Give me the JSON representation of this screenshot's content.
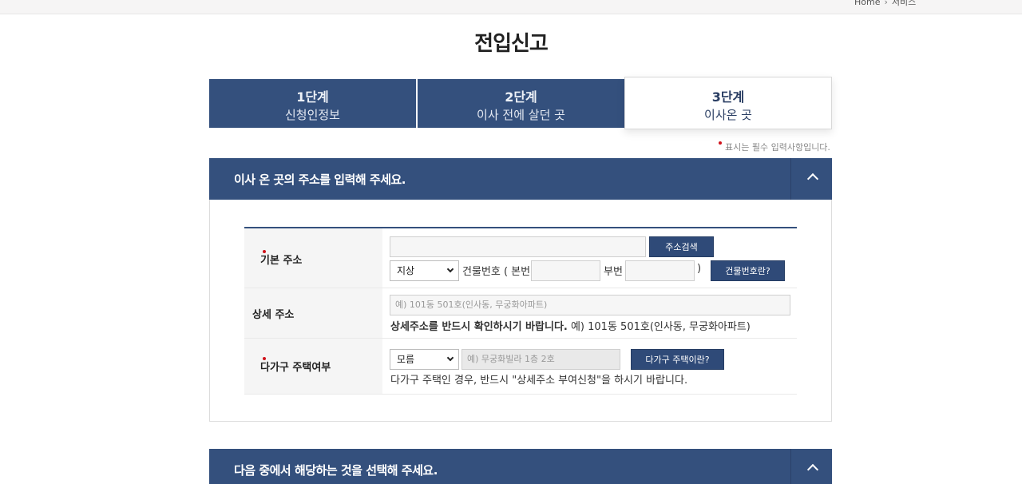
{
  "breadcrumb": {
    "home": "Home",
    "current": "서비스"
  },
  "page": {
    "title": "전입신고"
  },
  "steps": [
    {
      "num": "1단계",
      "name": "신청인정보"
    },
    {
      "num": "2단계",
      "name": "이사 전에 살던 곳"
    },
    {
      "num": "3단계",
      "name": "이사온 곳"
    }
  ],
  "required_note": "표시는 필수 입력사항입니다.",
  "section1": {
    "title": "이사 온 곳의 주소를 입력해 주세요."
  },
  "section2": {
    "title": "다음 중에서 해당하는 것을 선택해 주세요."
  },
  "form": {
    "basic_address": {
      "label": "기본 주소",
      "address_value": "",
      "search_button": "주소검색",
      "ground_select": "지상",
      "building_no_label": "건물번호 ( 본번",
      "main_no_value": "",
      "sub_no_label": "부번",
      "sub_no_value": "",
      "close_paren": ")",
      "building_help_button": "건물번호란?"
    },
    "detail_address": {
      "label": "상세 주소",
      "placeholder": "예) 101동 501호(인사동, 무궁화아파트)",
      "hint_bold": "상세주소를 반드시 확인하시기 바랍니다.",
      "hint_rest": " 예) 101동 501호(인사동, 무궁화아파트)"
    },
    "multi_household": {
      "label": "다가구 주택여부",
      "select_value": "모름",
      "placeholder": "예) 무궁화빌라 1층 2호",
      "help_button": "다가구 주택이란?",
      "hint": "다가구 주택인 경우, 반드시 \"상세주소 부여신청\"을 하시기 바랍니다."
    }
  },
  "colors": {
    "primary": "#34507d",
    "required": "#d0131b"
  }
}
